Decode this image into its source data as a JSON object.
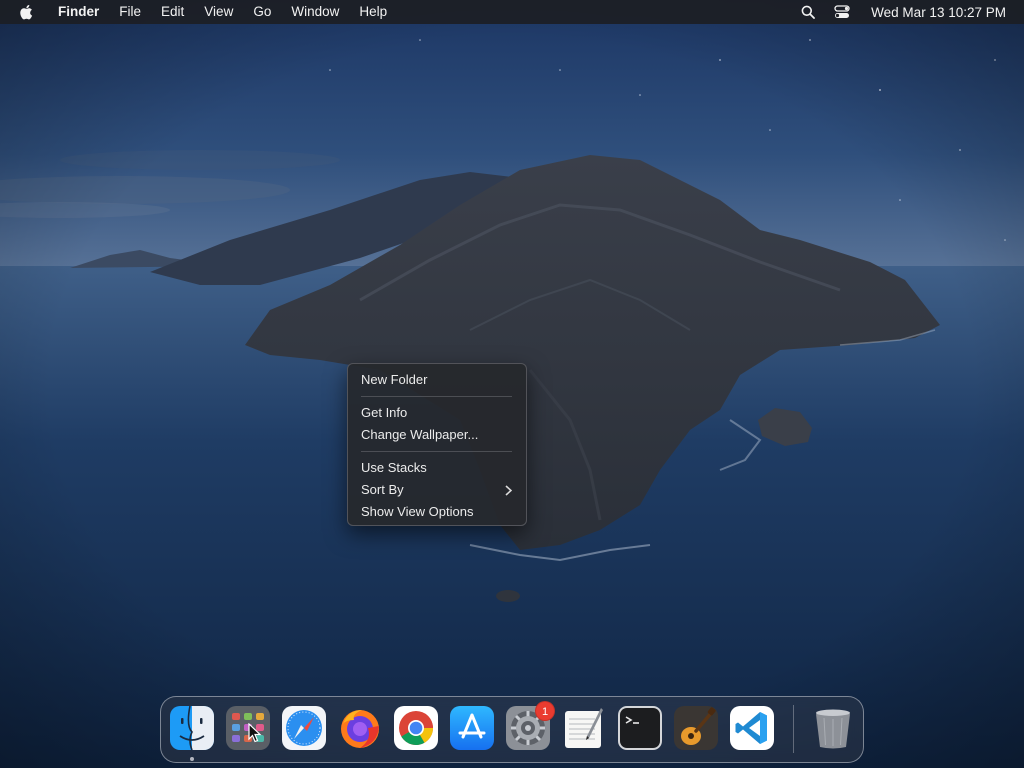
{
  "menubar": {
    "app_name": "Finder",
    "menus": [
      "File",
      "Edit",
      "View",
      "Go",
      "Window",
      "Help"
    ],
    "clock": "Wed Mar 13  10:27 PM",
    "icons": [
      "apple-logo",
      "search-icon",
      "control-center-icon"
    ]
  },
  "context_menu": {
    "groups": [
      [
        {
          "label": "New Folder"
        }
      ],
      [
        {
          "label": "Get Info"
        },
        {
          "label": "Change Wallpaper..."
        }
      ],
      [
        {
          "label": "Use Stacks"
        },
        {
          "label": "Sort By",
          "submenu": true
        },
        {
          "label": "Show View Options"
        }
      ]
    ]
  },
  "dock": {
    "apps": [
      {
        "name": "Finder",
        "icon": "finder-icon",
        "running": true
      },
      {
        "name": "Launchpad",
        "icon": "launchpad-icon"
      },
      {
        "name": "Safari",
        "icon": "safari-icon"
      },
      {
        "name": "Firefox",
        "icon": "firefox-icon"
      },
      {
        "name": "Google Chrome",
        "icon": "chrome-icon"
      },
      {
        "name": "App Store",
        "icon": "app-store-icon"
      },
      {
        "name": "System Preferences",
        "icon": "system-preferences-icon",
        "badge": "1"
      },
      {
        "name": "TextEdit",
        "icon": "textedit-icon"
      },
      {
        "name": "Terminal",
        "icon": "terminal-icon"
      },
      {
        "name": "GarageBand",
        "icon": "garageband-icon"
      },
      {
        "name": "Visual Studio Code",
        "icon": "vscode-icon"
      },
      {
        "name": "Trash",
        "icon": "trash-icon"
      }
    ]
  },
  "colors": {
    "menubar_bg": "#1c1e24",
    "menu_bg": "#26282c",
    "badge_red": "#ea3b30",
    "sky_top": "#203a66",
    "sea": "#1a3458"
  }
}
